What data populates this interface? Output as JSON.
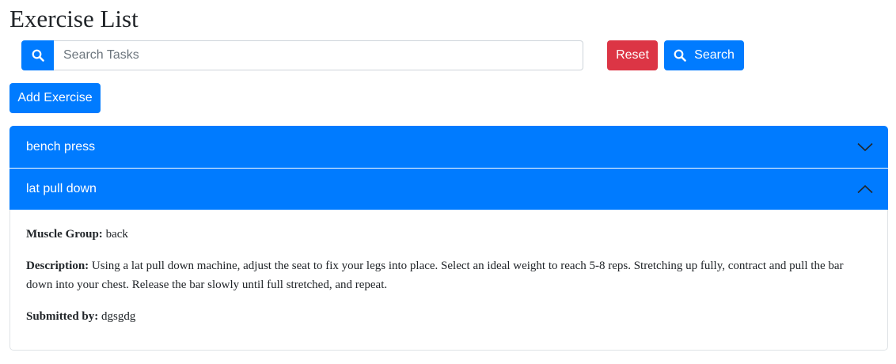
{
  "page": {
    "title": "Exercise List"
  },
  "search": {
    "placeholder": "Search Tasks",
    "value": "",
    "icon": "search-icon"
  },
  "buttons": {
    "reset_label": "Reset",
    "search_label": "Search",
    "add_label": "Add Exercise"
  },
  "colors": {
    "primary": "#007bff",
    "danger": "#dc3545"
  },
  "exercises": [
    {
      "name": "bench press",
      "expanded": false,
      "chevron": "chevron-down-icon"
    },
    {
      "name": "lat pull down",
      "expanded": true,
      "chevron": "chevron-up-icon",
      "muscle_group_label": "Muscle Group:",
      "muscle_group": "back",
      "description_label": "Description:",
      "description": "Using a lat pull down machine, adjust the seat to fix your legs into place. Select an ideal weight to reach 5-8 reps. Stretching up fully, contract and pull the bar down into your chest. Release the bar slowly until full stretched, and repeat.",
      "submitted_by_label": "Submitted by:",
      "submitted_by": "dgsgdg"
    }
  ]
}
